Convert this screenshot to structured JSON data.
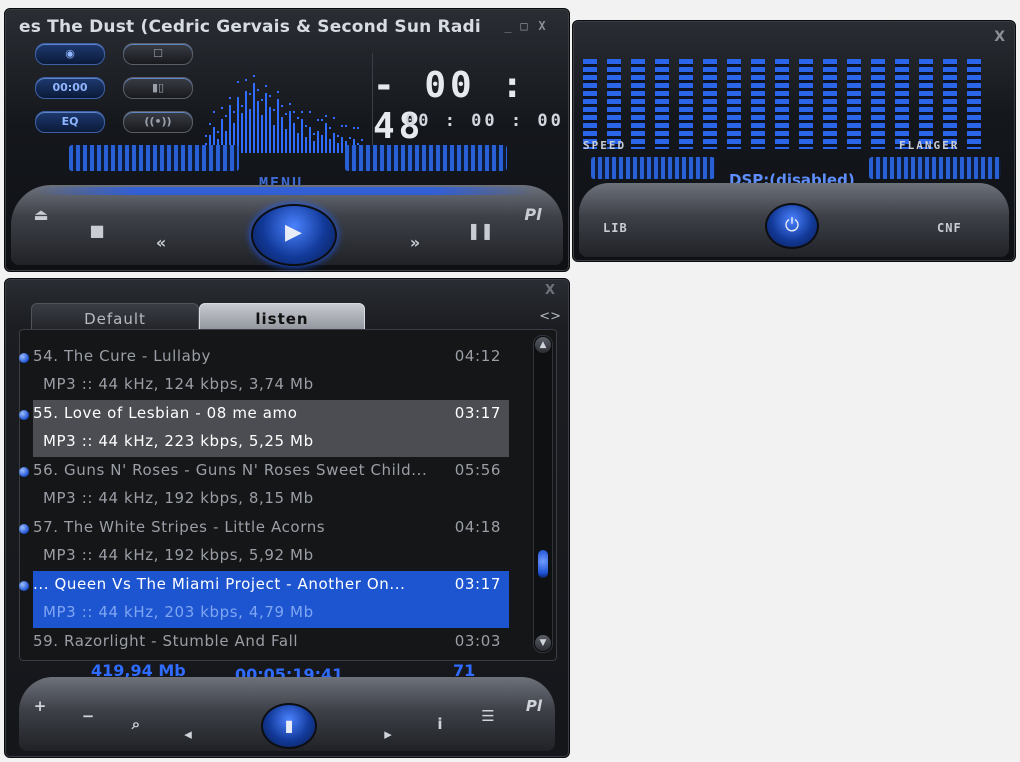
{
  "player": {
    "title": "es The Dust (Cedric Gervais & Second Sun Radi",
    "min_icon": "_",
    "max_icon": "□",
    "close_icon": "X",
    "buttons_left": [
      "◉",
      "00:00",
      "EQ"
    ],
    "buttons_right": [
      "☐",
      "▮▯",
      "((•))"
    ],
    "time_main": "- 00 : 48",
    "time_sub": "00 : 00 : 00",
    "menu_label": "MENU",
    "ctl_eject": "⏏",
    "ctl_stop": "■",
    "ctl_prev": "«",
    "ctl_next": "»",
    "ctl_pause": "❚❚",
    "ctl_pl": "Pl",
    "play_icon": "▶"
  },
  "eq": {
    "close": "X",
    "speed_label": "SPEED",
    "flanger_label": "FLANGER",
    "dsp_text": "DSP:(disabled)",
    "lib_label": "LIB",
    "cnf_label": "CNF",
    "power_icon": "⏻"
  },
  "playlist": {
    "close": "X",
    "tabs": [
      "Default",
      "listen"
    ],
    "tab_scroll": "<>",
    "rows": [
      {
        "title": "54. The Cure - Lullaby",
        "duration": "04:12",
        "info": "MP3 :: 44 kHz, 124 kbps, 3,74 Mb"
      },
      {
        "title": "55. Love of Lesbian - 08 me amo",
        "duration": "03:17",
        "info": "MP3 :: 44 kHz, 223 kbps, 5,25 Mb"
      },
      {
        "title": "56. Guns N' Roses - Guns N' Roses Sweet Child...",
        "duration": "05:56",
        "info": "MP3 :: 44 kHz, 192 kbps, 8,15 Mb"
      },
      {
        "title": "57. The White Stripes - Little Acorns",
        "duration": "04:18",
        "info": "MP3 :: 44 kHz, 192 kbps, 5,92 Mb"
      },
      {
        "title": "...  Queen Vs The Miami Project - Another On...",
        "duration": "03:17",
        "info": "MP3 :: 44 kHz, 203 kbps, 4,79 Mb"
      },
      {
        "title": "59. Razorlight - Stumble And Fall",
        "duration": "03:03",
        "info": ""
      }
    ],
    "total_size": "419,94 Mb",
    "total_time": "00:05:19:41",
    "count": "71",
    "ctl_add": "+",
    "ctl_remove": "−",
    "ctl_search": "⌕",
    "ctl_left": "◂",
    "ctl_center": "▮",
    "ctl_right": "▸",
    "ctl_info": "i",
    "ctl_list": "☰",
    "ctl_pl": "Pl"
  }
}
